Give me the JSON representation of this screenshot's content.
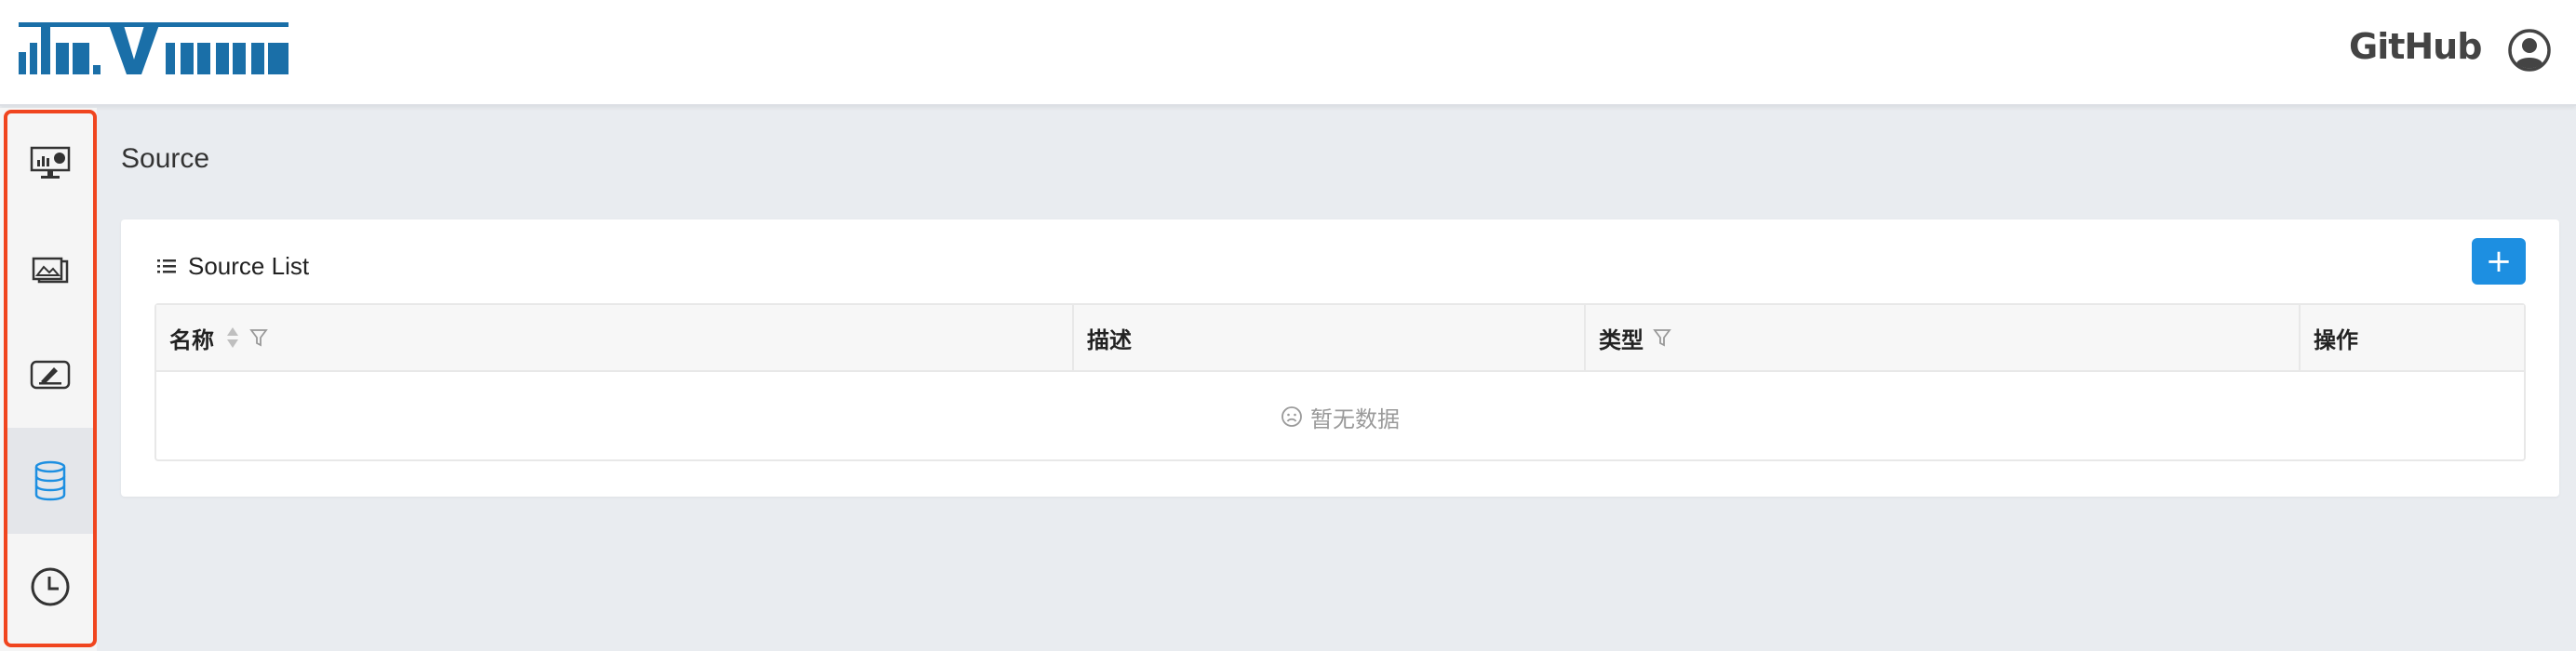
{
  "header": {
    "logo_text": "davinci",
    "github_label": "GitHub"
  },
  "sidebar": {
    "items": [
      {
        "name": "dashboard",
        "icon": "dashboard-monitor-icon",
        "active": false
      },
      {
        "name": "widget",
        "icon": "widget-image-icon",
        "active": false
      },
      {
        "name": "view",
        "icon": "view-edit-icon",
        "active": false
      },
      {
        "name": "source",
        "icon": "database-icon",
        "active": true
      },
      {
        "name": "schedule",
        "icon": "clock-icon",
        "active": false
      }
    ]
  },
  "main": {
    "page_title": "Source",
    "card_title": "Source List",
    "add_label": "+",
    "table": {
      "columns": [
        "名称",
        "描述",
        "类型",
        "操作"
      ],
      "empty_text": "暂无数据"
    }
  },
  "colors": {
    "accent": "#1d8fe1",
    "highlight_border": "#f0451f",
    "logo": "#1a6fa8"
  }
}
